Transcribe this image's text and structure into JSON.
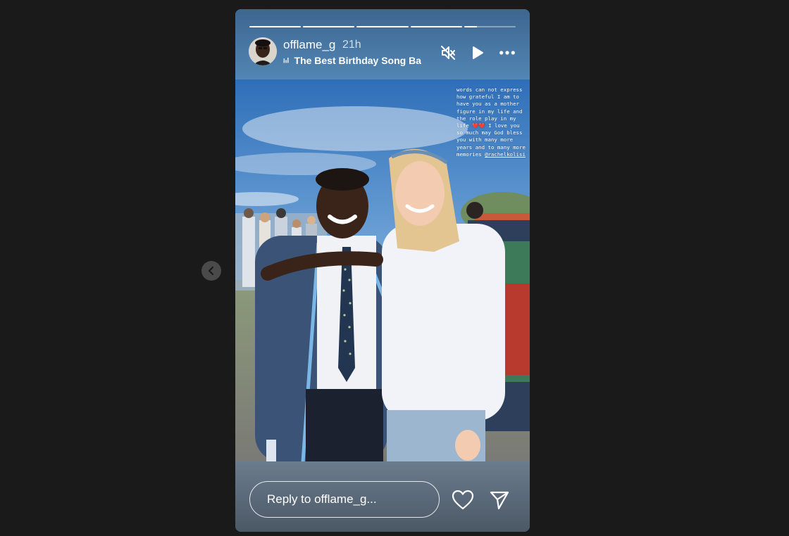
{
  "story": {
    "username": "offlame_g",
    "time": "21h",
    "song": "The Best Birthday Song Ba",
    "progress": [
      1,
      1,
      1,
      1,
      0.25
    ],
    "caption": "words can not express how grateful I am to have you as a mother figure in my life and the role play in my life ❤️❤️ I love you so much may God bless you with many more years and to many more memories",
    "caption_mention": "@rachelkolisi"
  },
  "reply": {
    "placeholder": "Reply to offlame_g..."
  },
  "icons": {
    "prev": "chevron-left-icon",
    "mute": "speaker-muted-icon",
    "play": "play-icon",
    "more": "more-horizontal-icon",
    "music": "music-bars-icon",
    "heart": "heart-icon",
    "share": "send-icon"
  },
  "colors": {
    "page_background": "#1a1a1a",
    "text": "#ffffff",
    "blazer": "#3a5377",
    "shirt_white": "#f0f2f6"
  }
}
